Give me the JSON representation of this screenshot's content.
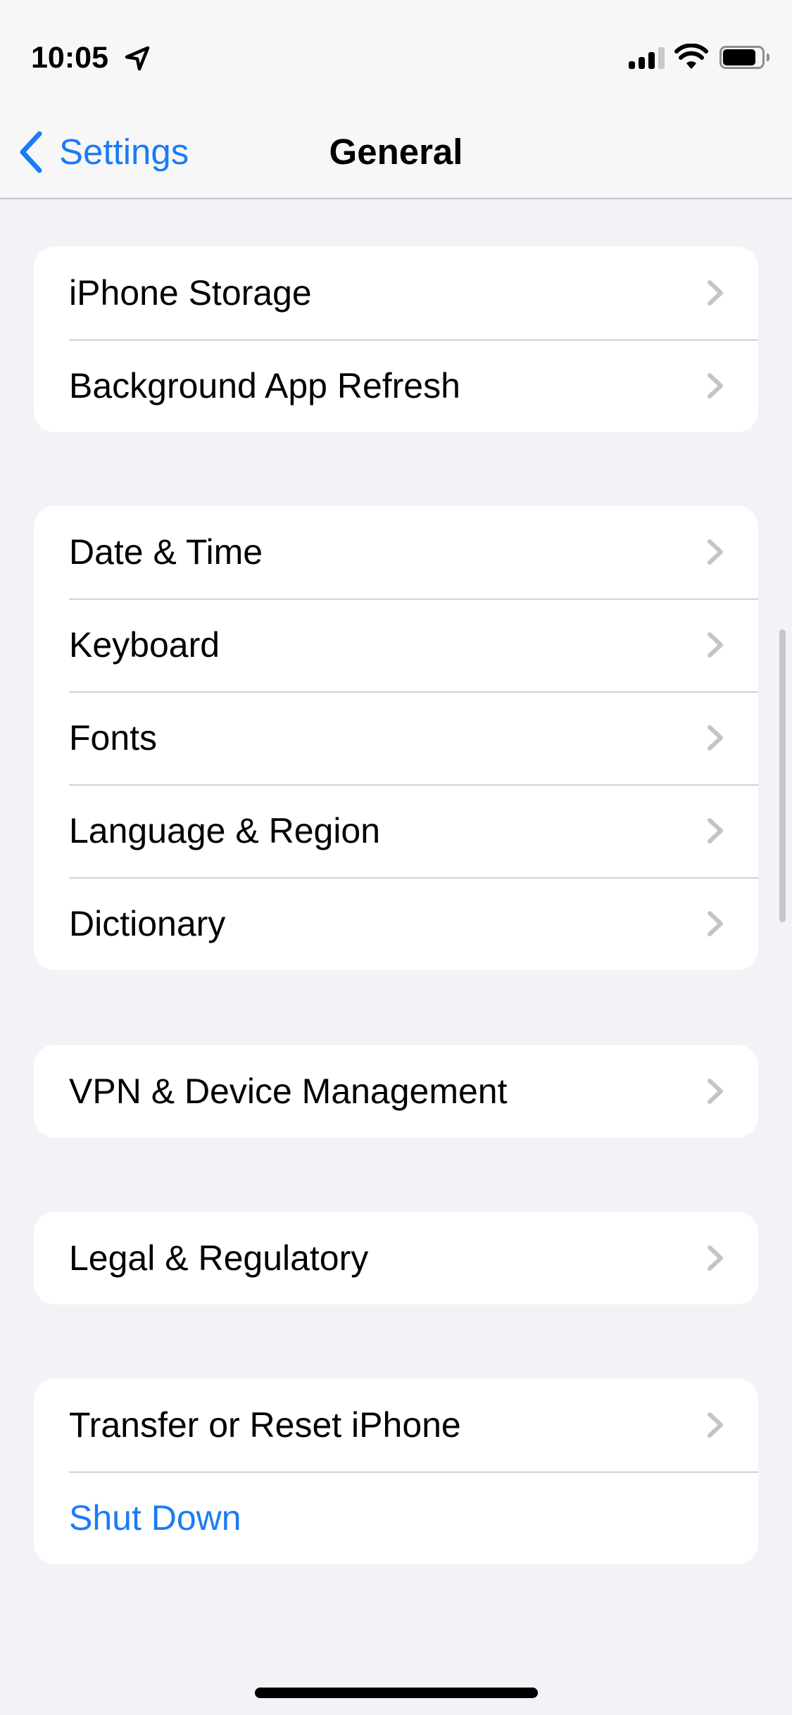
{
  "status_bar": {
    "time": "10:05",
    "location_icon": "location-arrow-icon",
    "signal_bars_active": 3,
    "signal_bars_total": 4,
    "wifi_icon": "wifi-icon",
    "battery_level": 0.85
  },
  "nav": {
    "back_label": "Settings",
    "title": "General"
  },
  "groups": [
    {
      "items": [
        {
          "label": "iPhone Storage",
          "chevron": true
        },
        {
          "label": "Background App Refresh",
          "chevron": true
        }
      ]
    },
    {
      "items": [
        {
          "label": "Date & Time",
          "chevron": true
        },
        {
          "label": "Keyboard",
          "chevron": true
        },
        {
          "label": "Fonts",
          "chevron": true
        },
        {
          "label": "Language & Region",
          "chevron": true
        },
        {
          "label": "Dictionary",
          "chevron": true
        }
      ]
    },
    {
      "items": [
        {
          "label": "VPN & Device Management",
          "chevron": true
        }
      ]
    },
    {
      "items": [
        {
          "label": "Legal & Regulatory",
          "chevron": true
        }
      ]
    },
    {
      "items": [
        {
          "label": "Transfer or Reset iPhone",
          "chevron": true
        },
        {
          "label": "Shut Down",
          "chevron": false,
          "style": "destructive-blue"
        }
      ]
    }
  ],
  "colors": {
    "accent": "#1A7CF5",
    "background": "#F2F2F7",
    "card": "#FFFFFF",
    "chevron": "#C4C4C7",
    "separator": "#D1D1D6"
  }
}
